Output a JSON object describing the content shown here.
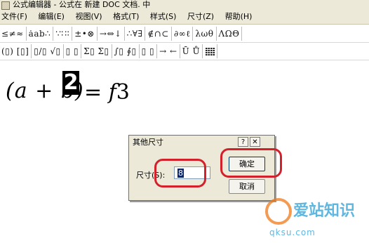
{
  "window": {
    "title": "公式编辑器 - 公式在 新建 DOC 文档. 中"
  },
  "menu": {
    "items": [
      "文件(F)",
      "编辑(E)",
      "视图(V)",
      "格式(T)",
      "样式(S)",
      "尺寸(Z)",
      "帮助(H)"
    ]
  },
  "toolbar": {
    "row1": [
      "≤≠≈",
      "ȧab∴",
      "∵∷∶",
      "±•⊗",
      "→⇔↓",
      "∴∀∃",
      "∉∩⊂",
      "∂∞ℓ",
      "λωθ",
      "ΛΩΘ"
    ],
    "row2": [
      "(▯) [▯]",
      "▯/▯ √▯",
      "▯ ▯",
      "Σ▯ Σ▯",
      "∫▯ ∮▯",
      "▯ ▯",
      "→ ←",
      "Ū Ů",
      "▪▪"
    ]
  },
  "formula": {
    "lhs": "(a + b)",
    "superscript": "2",
    "rhs_eq": "= ",
    "rhs_var": "f",
    "rhs_num": "3"
  },
  "dialog": {
    "title": "其他尺寸",
    "help_label": "?",
    "close_label": "✕",
    "size_label": "尺寸(S):",
    "size_value": "8",
    "ok_label": "确定",
    "cancel_label": "取消"
  },
  "watermark": {
    "text": "爱站知识",
    "url": "qksu.com"
  },
  "colors": {
    "annotation": "#d4202a",
    "window_chrome": "#ece9d8",
    "watermark": "#2a9fd6"
  }
}
